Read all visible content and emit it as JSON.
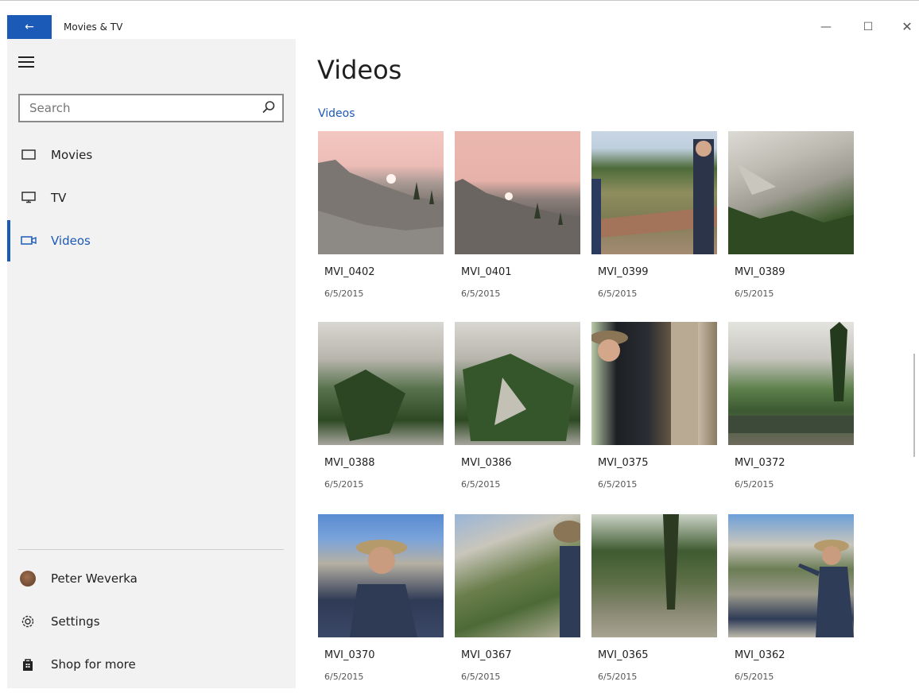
{
  "window": {
    "app_title": "Movies & TV",
    "back_icon": "←",
    "minimize_icon": "—",
    "maximize_icon": "☐",
    "close_icon": "✕"
  },
  "sidebar": {
    "search": {
      "placeholder": "Search",
      "value": ""
    },
    "nav": [
      {
        "label": "Movies",
        "icon": "movies-icon",
        "active": false
      },
      {
        "label": "TV",
        "icon": "tv-icon",
        "active": false
      },
      {
        "label": "Videos",
        "icon": "videos-icon",
        "active": true
      }
    ],
    "user_name": "Peter Weverka",
    "settings_label": "Settings",
    "shop_label": "Shop for more"
  },
  "main": {
    "page_title": "Videos",
    "section_title": "Videos",
    "videos": [
      {
        "name": "MVI_0402",
        "date": "6/5/2015"
      },
      {
        "name": "MVI_0401",
        "date": "6/5/2015"
      },
      {
        "name": "MVI_0399",
        "date": "6/5/2015"
      },
      {
        "name": "MVI_0389",
        "date": "6/5/2015"
      },
      {
        "name": "MVI_0388",
        "date": "6/5/2015"
      },
      {
        "name": "MVI_0386",
        "date": "6/5/2015"
      },
      {
        "name": "MVI_0375",
        "date": "6/5/2015"
      },
      {
        "name": "MVI_0372",
        "date": "6/5/2015"
      },
      {
        "name": "MVI_0370",
        "date": "6/5/2015"
      },
      {
        "name": "MVI_0367",
        "date": "6/5/2015"
      },
      {
        "name": "MVI_0365",
        "date": "6/5/2015"
      },
      {
        "name": "MVI_0362",
        "date": "6/5/2015"
      }
    ]
  },
  "colors": {
    "accent": "#1c5ab7",
    "sidebar_bg": "#f2f2f2"
  }
}
